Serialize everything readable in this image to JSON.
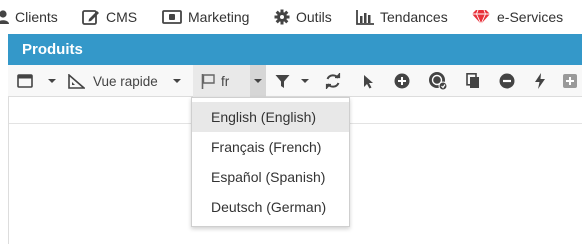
{
  "topnav": {
    "items": [
      {
        "label": "Clients",
        "icon": "user-icon"
      },
      {
        "label": "CMS",
        "icon": "edit-icon"
      },
      {
        "label": "Marketing",
        "icon": "money-icon"
      },
      {
        "label": "Outils",
        "icon": "gear-icon"
      },
      {
        "label": "Tendances",
        "icon": "bar-chart-icon"
      },
      {
        "label": "e-Services",
        "icon": "diamond-icon"
      }
    ]
  },
  "panel": {
    "title": "Produits"
  },
  "toolbar": {
    "quick_view_label": "Vue rapide",
    "language_value": "fr"
  },
  "language_menu": {
    "options": [
      "English (English)",
      "Français (French)",
      "Español (Spanish)",
      "Deutsch (German)"
    ],
    "highlighted": "English (English)"
  },
  "colors": {
    "header": "#3498c9",
    "accent_red": "#e8303a"
  }
}
